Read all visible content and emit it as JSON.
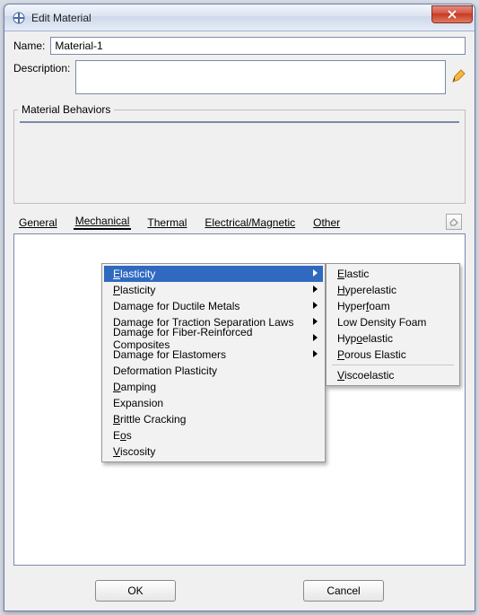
{
  "window_title": "Edit Material",
  "name_label": "Name:",
  "name_value": "Material-1",
  "description_label": "Description:",
  "description_value": "",
  "behaviors_label": "Material Behaviors",
  "tabs": {
    "general": "General",
    "mechanical": "Mechanical",
    "thermal": "Thermal",
    "electrical": "Electrical/Magnetic",
    "other": "Other"
  },
  "mechanical_menu": [
    {
      "label": "Elasticity",
      "ul": 0,
      "submenu": true,
      "selected": true
    },
    {
      "label": "Plasticity",
      "ul": 0,
      "submenu": true
    },
    {
      "label": "Damage for Ductile Metals",
      "submenu": true
    },
    {
      "label": "Damage for Traction Separation Laws",
      "submenu": true
    },
    {
      "label": "Damage for Fiber-Reinforced Composites",
      "submenu": true
    },
    {
      "label": "Damage for Elastomers",
      "submenu": true
    },
    {
      "label": "Deformation Plasticity"
    },
    {
      "label": "Damping",
      "ul": 0
    },
    {
      "label": "Expansion"
    },
    {
      "label": "Brittle Cracking",
      "ul": 0
    },
    {
      "label": "Eos",
      "ul": 1
    },
    {
      "label": "Viscosity",
      "ul": 0
    }
  ],
  "elasticity_submenu": [
    {
      "label": "Elastic",
      "ul": 0
    },
    {
      "label": "Hyperelastic",
      "ul": 0
    },
    {
      "label": "Hyperfoam",
      "ul": 5
    },
    {
      "label": "Low Density Foam"
    },
    {
      "label": "Hypoelastic",
      "ul": 3
    },
    {
      "label": "Porous Elastic",
      "ul": 0
    },
    {
      "sep": true
    },
    {
      "label": "Viscoelastic",
      "ul": 0
    }
  ],
  "buttons": {
    "ok": "OK",
    "cancel": "Cancel"
  }
}
